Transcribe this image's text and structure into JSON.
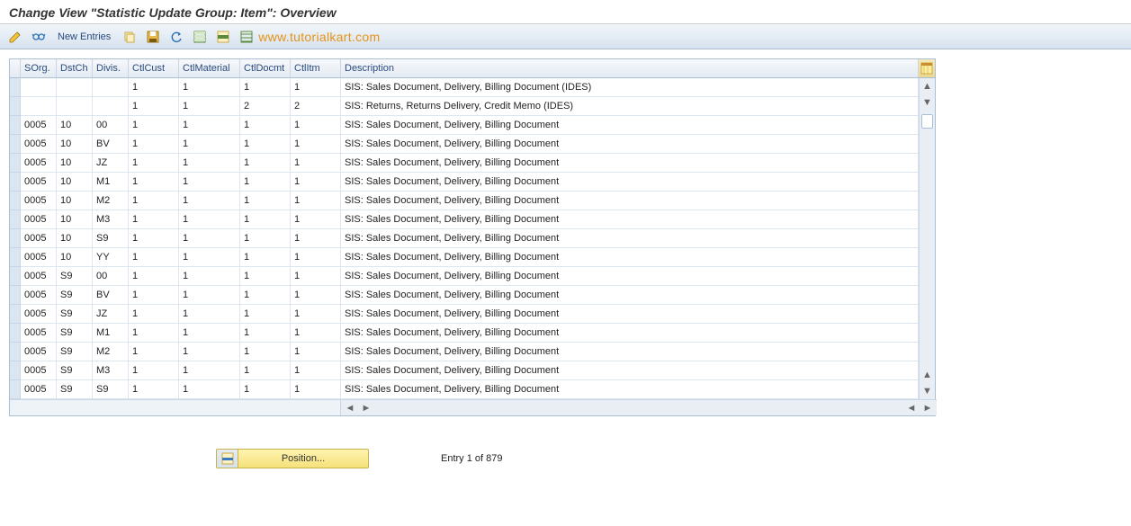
{
  "title": "Change View \"Statistic Update Group: Item\": Overview",
  "toolbar": {
    "new_entries_label": "New Entries"
  },
  "watermark": "www.tutorialkart.com",
  "table": {
    "columns": [
      "SOrg.",
      "DstCh",
      "Divis.",
      "CtlCust",
      "CtlMaterial",
      "CtlDocmt",
      "CtlItm",
      "Description"
    ],
    "rows": [
      {
        "sorg": "",
        "dstch": "",
        "divis": "",
        "ctlcust": "1",
        "ctlmat": "1",
        "ctldoc": "1",
        "ctlitm": "1",
        "desc": "SIS: Sales Document, Delivery, Billing Document (IDES)"
      },
      {
        "sorg": "",
        "dstch": "",
        "divis": "",
        "ctlcust": "1",
        "ctlmat": "1",
        "ctldoc": "2",
        "ctlitm": "2",
        "desc": "SIS: Returns, Returns Delivery, Credit Memo (IDES)"
      },
      {
        "sorg": "0005",
        "dstch": "10",
        "divis": "00",
        "ctlcust": "1",
        "ctlmat": "1",
        "ctldoc": "1",
        "ctlitm": "1",
        "desc": "SIS: Sales Document, Delivery, Billing Document"
      },
      {
        "sorg": "0005",
        "dstch": "10",
        "divis": "BV",
        "ctlcust": "1",
        "ctlmat": "1",
        "ctldoc": "1",
        "ctlitm": "1",
        "desc": "SIS: Sales Document, Delivery, Billing Document"
      },
      {
        "sorg": "0005",
        "dstch": "10",
        "divis": "JZ",
        "ctlcust": "1",
        "ctlmat": "1",
        "ctldoc": "1",
        "ctlitm": "1",
        "desc": "SIS: Sales Document, Delivery, Billing Document"
      },
      {
        "sorg": "0005",
        "dstch": "10",
        "divis": "M1",
        "ctlcust": "1",
        "ctlmat": "1",
        "ctldoc": "1",
        "ctlitm": "1",
        "desc": "SIS: Sales Document, Delivery, Billing Document"
      },
      {
        "sorg": "0005",
        "dstch": "10",
        "divis": "M2",
        "ctlcust": "1",
        "ctlmat": "1",
        "ctldoc": "1",
        "ctlitm": "1",
        "desc": "SIS: Sales Document, Delivery, Billing Document"
      },
      {
        "sorg": "0005",
        "dstch": "10",
        "divis": "M3",
        "ctlcust": "1",
        "ctlmat": "1",
        "ctldoc": "1",
        "ctlitm": "1",
        "desc": "SIS: Sales Document, Delivery, Billing Document"
      },
      {
        "sorg": "0005",
        "dstch": "10",
        "divis": "S9",
        "ctlcust": "1",
        "ctlmat": "1",
        "ctldoc": "1",
        "ctlitm": "1",
        "desc": "SIS: Sales Document, Delivery, Billing Document"
      },
      {
        "sorg": "0005",
        "dstch": "10",
        "divis": "YY",
        "ctlcust": "1",
        "ctlmat": "1",
        "ctldoc": "1",
        "ctlitm": "1",
        "desc": "SIS: Sales Document, Delivery, Billing Document"
      },
      {
        "sorg": "0005",
        "dstch": "S9",
        "divis": "00",
        "ctlcust": "1",
        "ctlmat": "1",
        "ctldoc": "1",
        "ctlitm": "1",
        "desc": "SIS: Sales Document, Delivery, Billing Document"
      },
      {
        "sorg": "0005",
        "dstch": "S9",
        "divis": "BV",
        "ctlcust": "1",
        "ctlmat": "1",
        "ctldoc": "1",
        "ctlitm": "1",
        "desc": "SIS: Sales Document, Delivery, Billing Document"
      },
      {
        "sorg": "0005",
        "dstch": "S9",
        "divis": "JZ",
        "ctlcust": "1",
        "ctlmat": "1",
        "ctldoc": "1",
        "ctlitm": "1",
        "desc": "SIS: Sales Document, Delivery, Billing Document"
      },
      {
        "sorg": "0005",
        "dstch": "S9",
        "divis": "M1",
        "ctlcust": "1",
        "ctlmat": "1",
        "ctldoc": "1",
        "ctlitm": "1",
        "desc": "SIS: Sales Document, Delivery, Billing Document"
      },
      {
        "sorg": "0005",
        "dstch": "S9",
        "divis": "M2",
        "ctlcust": "1",
        "ctlmat": "1",
        "ctldoc": "1",
        "ctlitm": "1",
        "desc": "SIS: Sales Document, Delivery, Billing Document"
      },
      {
        "sorg": "0005",
        "dstch": "S9",
        "divis": "M3",
        "ctlcust": "1",
        "ctlmat": "1",
        "ctldoc": "1",
        "ctlitm": "1",
        "desc": "SIS: Sales Document, Delivery, Billing Document"
      },
      {
        "sorg": "0005",
        "dstch": "S9",
        "divis": "S9",
        "ctlcust": "1",
        "ctlmat": "1",
        "ctldoc": "1",
        "ctlitm": "1",
        "desc": "SIS: Sales Document, Delivery, Billing Document"
      }
    ]
  },
  "footer": {
    "position_label": "Position...",
    "entry_text": "Entry 1 of 879"
  },
  "icons": {
    "toggle": "toggle-display-change-icon",
    "glasses": "other-view-icon",
    "copy": "copy-icon",
    "save": "save-icon",
    "undo": "undo-icon",
    "select_all": "select-all-icon",
    "select_block": "select-block-icon",
    "deselect": "deselect-all-icon",
    "config": "table-settings-icon"
  }
}
